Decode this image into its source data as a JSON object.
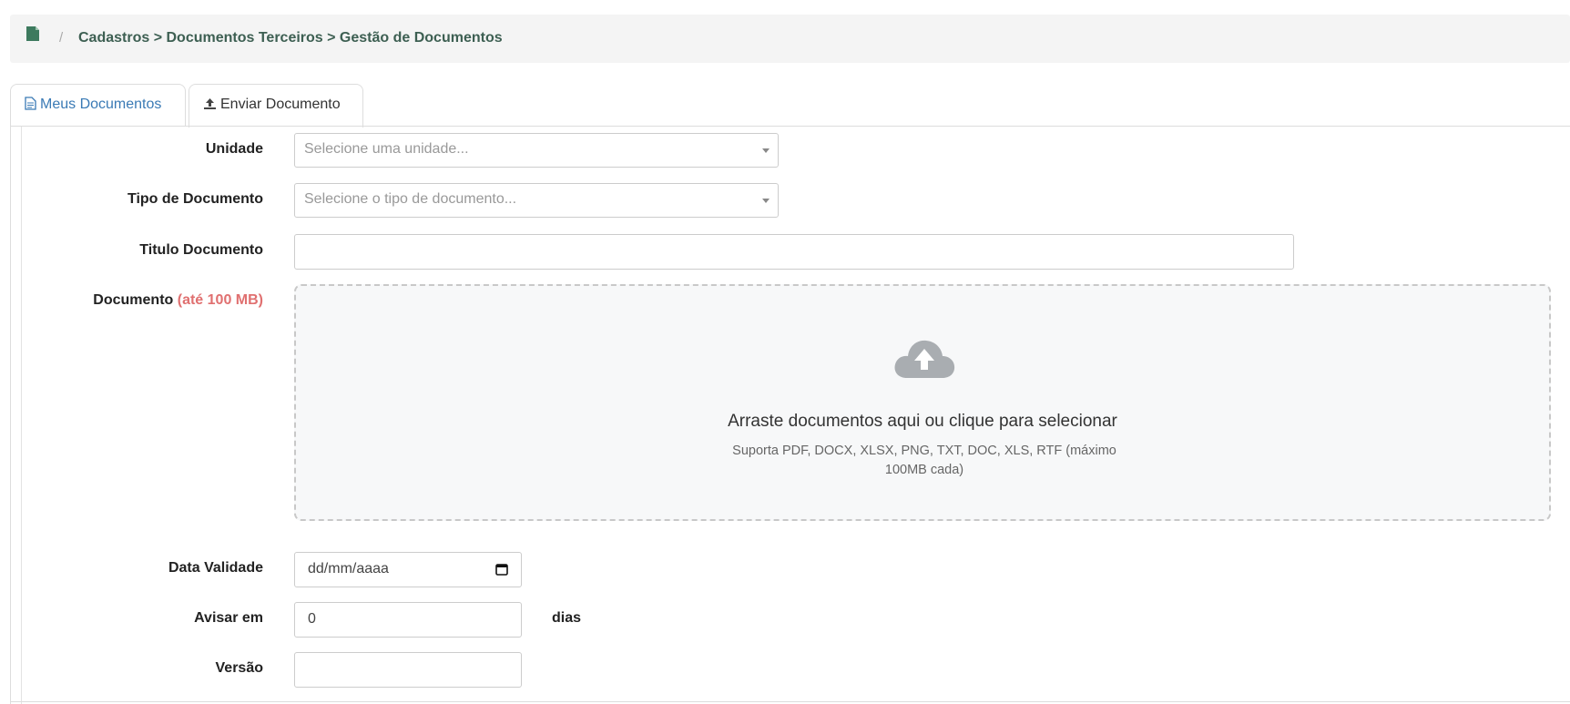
{
  "breadcrumb": {
    "icon": "document-icon",
    "separator": "/",
    "path": "Cadastros > Documentos Terceiros > Gestão de Documentos"
  },
  "tabs": [
    {
      "label": "Meus Documentos",
      "icon": "file-text-icon",
      "active": false
    },
    {
      "label": "Enviar Documento",
      "icon": "upload-icon",
      "active": true
    }
  ],
  "form": {
    "unidade": {
      "label": "Unidade",
      "placeholder": "Selecione uma unidade..."
    },
    "tipo": {
      "label": "Tipo de Documento",
      "placeholder": "Selecione o tipo de documento..."
    },
    "titulo": {
      "label": "Titulo Documento",
      "value": ""
    },
    "documento": {
      "label": "Documento",
      "hint": "(até 100 MB)",
      "drop_title": "Arraste documentos aqui ou clique para selecionar",
      "drop_subtitle": "Suporta PDF, DOCX, XLSX, PNG, TXT, DOC, XLS, RTF (máximo 100MB cada)"
    },
    "validade": {
      "label": "Data Validade",
      "placeholder": "dd/mm/aaaa"
    },
    "avisar": {
      "label": "Avisar em",
      "value": "0",
      "suffix": "dias"
    },
    "versao": {
      "label": "Versão",
      "value": ""
    }
  },
  "colors": {
    "accent": "#3d7a5e",
    "hint": "#e07070",
    "tab_link": "#3a7ab5"
  }
}
